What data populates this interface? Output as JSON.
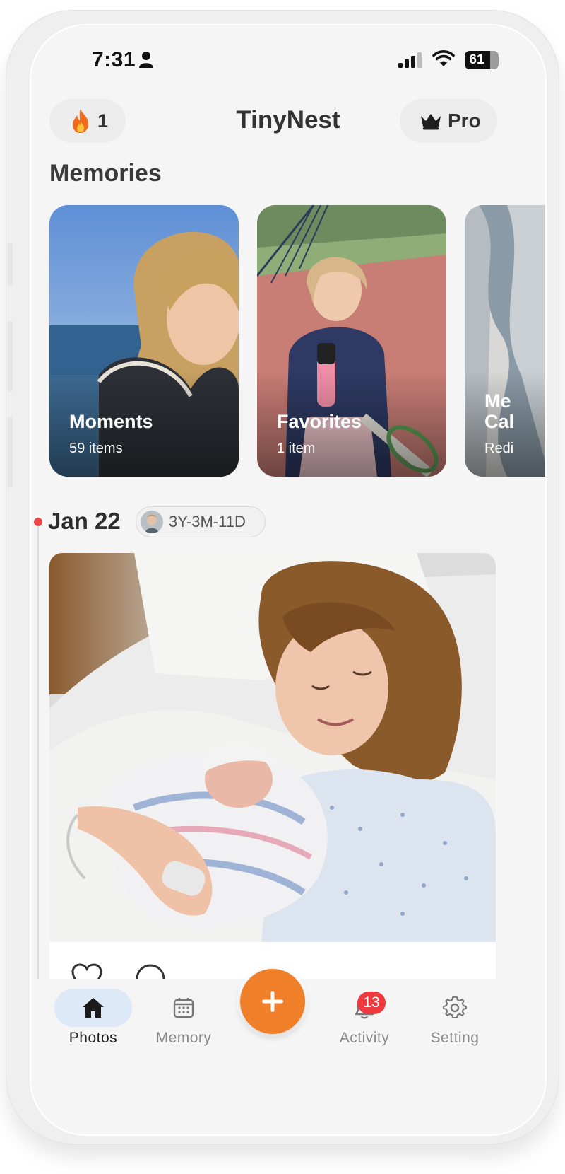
{
  "status_bar": {
    "time": "7:31",
    "battery": "61"
  },
  "header": {
    "streak_count": "1",
    "title": "TinyNest",
    "pro_label": "Pro"
  },
  "memories": {
    "title": "Memories",
    "cards": [
      {
        "title": "Moments",
        "subtitle": "59 items"
      },
      {
        "title": "Favorites",
        "subtitle": "1 item"
      },
      {
        "title_line1": "Me",
        "title_line2": "Cal",
        "subtitle": "Redi"
      }
    ]
  },
  "timeline": {
    "date": "Jan 22",
    "age": "3Y-3M-11D"
  },
  "tabs": [
    {
      "label": "Photos",
      "icon": "home-icon",
      "active": true
    },
    {
      "label": "Memory",
      "icon": "calendar-icon",
      "active": false
    },
    {
      "label": "Activity",
      "icon": "bell-icon",
      "active": false,
      "badge": "13"
    },
    {
      "label": "Setting",
      "icon": "gear-icon",
      "active": false
    }
  ],
  "colors": {
    "accent": "#f07f2a",
    "badge": "#f0393e",
    "active_tab": "#dde9f7"
  }
}
